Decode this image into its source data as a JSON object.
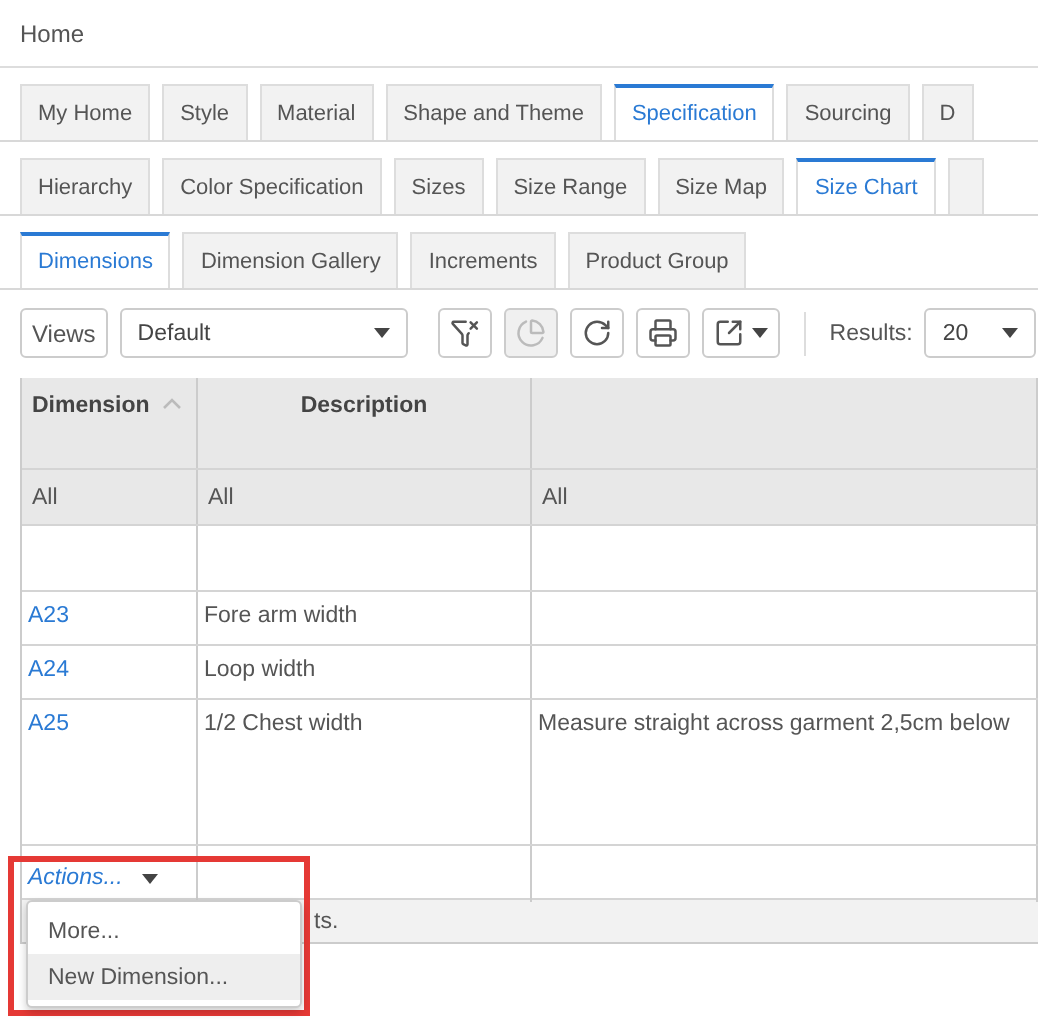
{
  "breadcrumb": "Home",
  "tab_rows": [
    [
      {
        "label": "My Home",
        "selected": false
      },
      {
        "label": "Style",
        "selected": false
      },
      {
        "label": "Material",
        "selected": false
      },
      {
        "label": "Shape and Theme",
        "selected": false
      },
      {
        "label": "Specification",
        "selected": true
      },
      {
        "label": "Sourcing",
        "selected": false
      },
      {
        "label": "D",
        "selected": false
      }
    ],
    [
      {
        "label": "Hierarchy",
        "selected": false
      },
      {
        "label": "Color Specification",
        "selected": false
      },
      {
        "label": "Sizes",
        "selected": false
      },
      {
        "label": "Size Range",
        "selected": false
      },
      {
        "label": "Size Map",
        "selected": false
      },
      {
        "label": "Size Chart",
        "selected": true
      },
      {
        "selected": false
      }
    ],
    [
      {
        "label": "Dimensions",
        "selected": true
      },
      {
        "label": "Dimension Gallery",
        "selected": false
      },
      {
        "label": "Increments",
        "selected": false
      },
      {
        "label": "Product Group",
        "selected": false
      }
    ]
  ],
  "toolbar": {
    "views_label": "Views",
    "view_value": "Default",
    "buttons": [
      {
        "kind": "clear-filter",
        "disabled": false
      },
      {
        "kind": "chart",
        "disabled": true
      },
      {
        "kind": "refresh",
        "disabled": false
      },
      {
        "kind": "print",
        "disabled": false
      },
      {
        "kind": "export",
        "disabled": false
      }
    ],
    "results_label": "Results:",
    "results_value": "20"
  },
  "table": {
    "columns": [
      {
        "label": "Dimension",
        "sorted": true
      },
      {
        "label": "Description",
        "sorted": false
      },
      {
        "sorted": false
      }
    ],
    "filters": [
      "All",
      "All",
      "All"
    ],
    "rows": [
      {
        "cells": []
      },
      {
        "cells": [
          "A23",
          "Fore arm width"
        ]
      },
      {
        "cells": [
          "A24",
          "Loop width"
        ]
      },
      {
        "cells": [
          "A25",
          "1/2 Chest width",
          "Measure straight across garment 2,5cm below"
        ]
      }
    ],
    "actions_label": "Actions...",
    "footer": "ts."
  },
  "actions_menu": [
    {
      "label": "More...",
      "highlighted": false
    },
    {
      "label": "New Dimension...",
      "highlighted": true
    }
  ]
}
